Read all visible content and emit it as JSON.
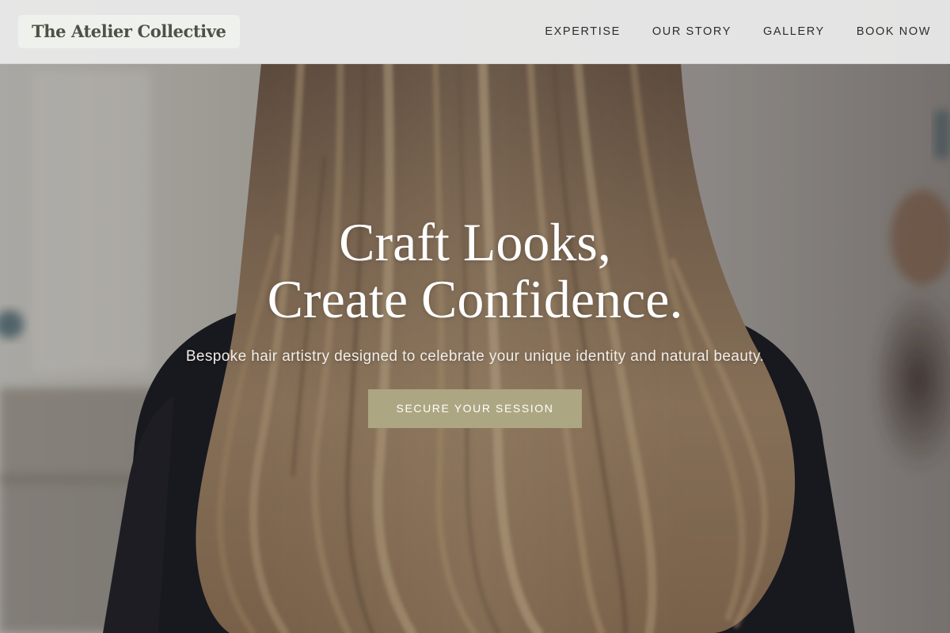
{
  "brand": {
    "name": "The Atelier Collective"
  },
  "nav": {
    "items": [
      {
        "label": "EXPERTISE"
      },
      {
        "label": "OUR STORY"
      },
      {
        "label": "GALLERY"
      },
      {
        "label": "BOOK NOW"
      }
    ]
  },
  "hero": {
    "title_line_1": "Craft Looks,",
    "title_line_2": "Create Confidence.",
    "subtitle": "Bespoke hair artistry designed to celebrate your unique identity and natural beauty.",
    "cta_label": "SECURE YOUR SESSION",
    "background": "photo of woman with long balayage hair in a salon"
  },
  "colors": {
    "header_bg": "#e8e8e8",
    "logo_bg": "#eff1ec",
    "logo_text": "#4b5246",
    "nav_text": "#2d2d2d",
    "cta_bg": "#aca682",
    "hero_text": "#ffffff"
  }
}
